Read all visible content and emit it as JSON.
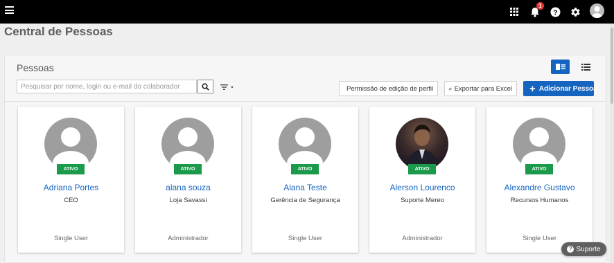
{
  "topbar": {
    "notification_count": "1",
    "icons": [
      "menu-icon",
      "apps-grid-icon",
      "bell-icon",
      "help-icon",
      "gear-icon",
      "user-avatar"
    ]
  },
  "page": {
    "title": "Central de Pessoas"
  },
  "panel": {
    "title": "Pessoas",
    "search_placeholder": "Pesquisar por nome, login ou e-mail do colaborador",
    "permission_button": "Permissão de edição de perfil",
    "export_button": "Exportar para Excel",
    "add_button": "Adicionar Pessoa"
  },
  "people": [
    {
      "name": "Adriana Portes",
      "role": "CEO",
      "type": "Single User",
      "status": "ATIVO",
      "avatar": "default-avatar"
    },
    {
      "name": "alana souza",
      "role": "Loja Savassi",
      "type": "Administrador",
      "status": "ATIVO",
      "avatar": "default-avatar"
    },
    {
      "name": "Alana Teste",
      "role": "Gerência de Segurança",
      "type": "Single User",
      "status": "ATIVO",
      "avatar": "default-avatar"
    },
    {
      "name": "Alerson Lourenco",
      "role": "Suporte Mereo",
      "type": "Administrador",
      "status": "ATIVO",
      "avatar": "photo"
    },
    {
      "name": "Alexandre Gustavo",
      "role": "Recursos Humanos",
      "type": "Single User",
      "status": "ATIVO",
      "avatar": "default-avatar"
    }
  ],
  "support": {
    "label": "Suporte"
  },
  "colors": {
    "topbar": "#000000",
    "primary": "#1565c0",
    "active_badge": "#1a9a4a",
    "name_link": "#1565c0"
  }
}
